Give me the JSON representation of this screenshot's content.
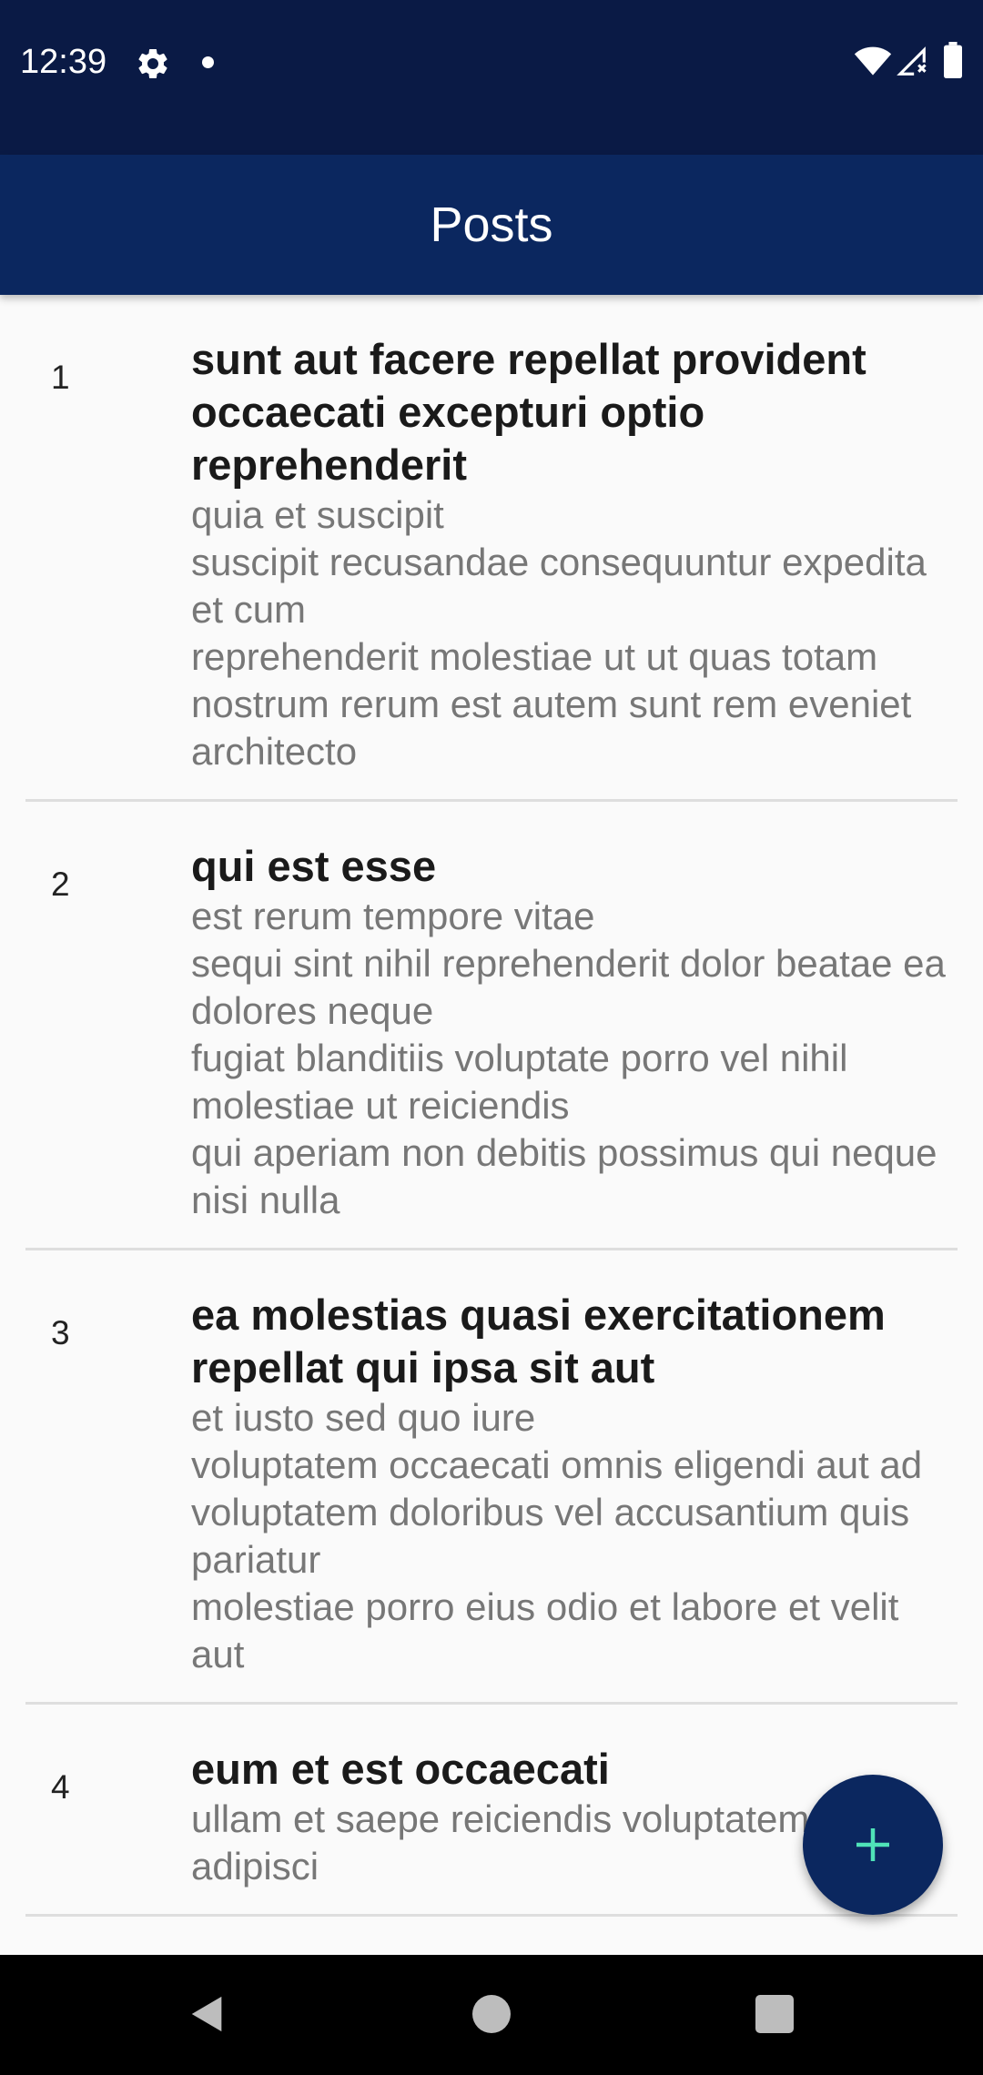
{
  "status_bar": {
    "time": "12:39",
    "icons": [
      "gear-icon",
      "notification-dot-icon",
      "wifi-icon",
      "signal-icon",
      "battery-icon"
    ]
  },
  "app_bar": {
    "title": "Posts"
  },
  "posts": [
    {
      "id": "1",
      "title": "sunt aut facere repellat provident occaecati excepturi optio reprehenderit",
      "body": "quia et suscipit\nsuscipit recusandae consequuntur expedita et cum\nreprehenderit molestiae ut ut quas totam\nnostrum rerum est autem sunt rem eveniet architecto"
    },
    {
      "id": "2",
      "title": "qui est esse",
      "body": "est rerum tempore vitae\nsequi sint nihil reprehenderit dolor beatae ea dolores neque\nfugiat blanditiis voluptate porro vel nihil molestiae ut reiciendis\nqui aperiam non debitis possimus qui neque nisi nulla"
    },
    {
      "id": "3",
      "title": "ea molestias quasi exercitationem repellat qui ipsa sit aut",
      "body": "et iusto sed quo iure\nvoluptatem occaecati omnis eligendi aut ad\nvoluptatem doloribus vel accusantium quis pariatur\nmolestiae porro eius odio et labore et velit aut"
    },
    {
      "id": "4",
      "title": "eum et est occaecati",
      "body": "ullam et saepe reiciendis voluptatem adipisci"
    }
  ],
  "fab": {
    "icon": "plus-icon"
  },
  "nav_bar": {
    "icons": [
      "back-icon",
      "home-icon",
      "recents-icon"
    ]
  },
  "colors": {
    "primary": "#0b275f",
    "status_bar": "#0a1a45",
    "fab_icon": "#4fe3b8",
    "title_text": "#1a1a1a",
    "body_text": "#777777"
  }
}
